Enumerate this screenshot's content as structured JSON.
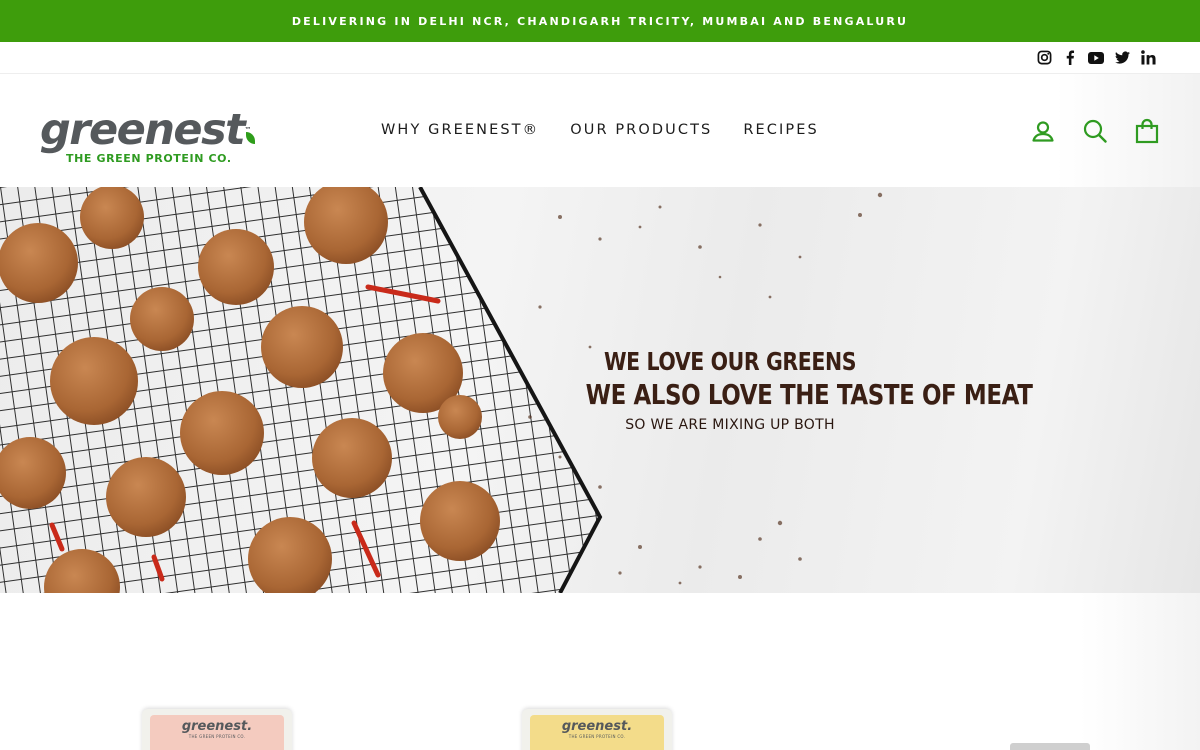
{
  "announcement": "DELIVERING IN DELHI NCR, CHANDIGARH TRICITY, MUMBAI AND BENGALURU",
  "social": [
    "instagram-icon",
    "facebook-icon",
    "youtube-icon",
    "twitter-icon",
    "linkedin-icon"
  ],
  "logo": {
    "word": "greenest",
    "tm": "™",
    "tagline": "THE GREEN PROTEIN CO."
  },
  "nav": [
    {
      "label": "WHY GREENEST®"
    },
    {
      "label": "OUR PRODUCTS"
    },
    {
      "label": "RECIPES"
    }
  ],
  "header_icons": [
    "account-icon",
    "search-icon",
    "cart-icon"
  ],
  "hero": {
    "line1": "WE LOVE OUR GREENS",
    "line2": "WE ALSO LOVE THE TASTE OF MEAT",
    "line3": "SO WE ARE MIXING UP BOTH"
  },
  "products": [
    {
      "brand": "greenest.",
      "sub": "THE GREEN PROTEIN CO.",
      "color": "#f4cbbf"
    },
    {
      "brand": "greenest.",
      "sub": "THE GREEN PROTEIN CO.",
      "color": "#f3dc8a"
    }
  ],
  "colors": {
    "brand_green": "#3e9d0c",
    "logo_grey": "#55595c",
    "hero_text": "#3a1f14"
  }
}
